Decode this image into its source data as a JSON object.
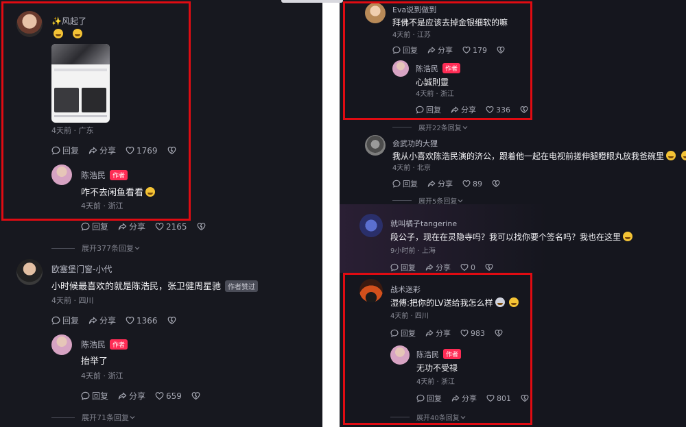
{
  "colors": {
    "accent": "#fe2c55",
    "highlight_box": "#e00b12",
    "background": "#17181f"
  },
  "action_labels": {
    "reply": "回复",
    "share": "分享"
  },
  "left": {
    "c1": {
      "name": "✨风起了",
      "time": "4天前 · 广东",
      "likes": "1769",
      "image_icon": "screenshot-thumbnail"
    },
    "c1r": {
      "name": "陈浩民",
      "badge": "作者",
      "text": "咋不去闲鱼看看",
      "time": "4天前 · 浙江",
      "likes": "2165"
    },
    "expand1": "展开377条回复",
    "c2": {
      "name": "欧塞堡门窗-小代",
      "text": "小时候最喜欢的就是陈浩民，张卫健周星驰",
      "badge": "作者赞过",
      "time": "4天前 · 四川",
      "likes": "1366"
    },
    "c2r": {
      "name": "陈浩民",
      "badge": "作者",
      "text": "抬举了",
      "time": "4天前 · 浙江",
      "likes": "659"
    },
    "expand2": "展开71条回复"
  },
  "right": {
    "c1": {
      "name": "Eva说到做到",
      "text": "拜佛不是应该去掉金银细软的嘛",
      "time": "4天前 · 江苏",
      "likes": "179"
    },
    "c1r": {
      "name": "陈浩民",
      "badge": "作者",
      "text": "心誠則靈",
      "time": "4天前 · 浙江",
      "likes": "336"
    },
    "expand1": "展开22条回复",
    "c2": {
      "name": "会武功的大狸",
      "text": "我从小喜欢陈浩民演的济公，跟着他一起在电视前搓伸腿瞪眼丸放我爸碗里",
      "time": "4天前 · 北京",
      "likes": "89"
    },
    "expand2": "展开5条回复",
    "c3": {
      "name": "就叫橘子tangerine",
      "text": "段公子，现在在灵隐寺吗？我可以找你要个签名吗？我也在这里",
      "time": "9小时前 · 上海",
      "likes": "0"
    },
    "c4": {
      "name": "战术迷彩",
      "text": "湿傅:把你的LV送给我怎么样",
      "time": "4天前 · 四川",
      "likes": "983"
    },
    "c4r": {
      "name": "陈浩民",
      "badge": "作者",
      "text": "无功不受禄",
      "time": "4天前 · 浙江",
      "likes": "801"
    },
    "expand3": "展开40条回复"
  }
}
